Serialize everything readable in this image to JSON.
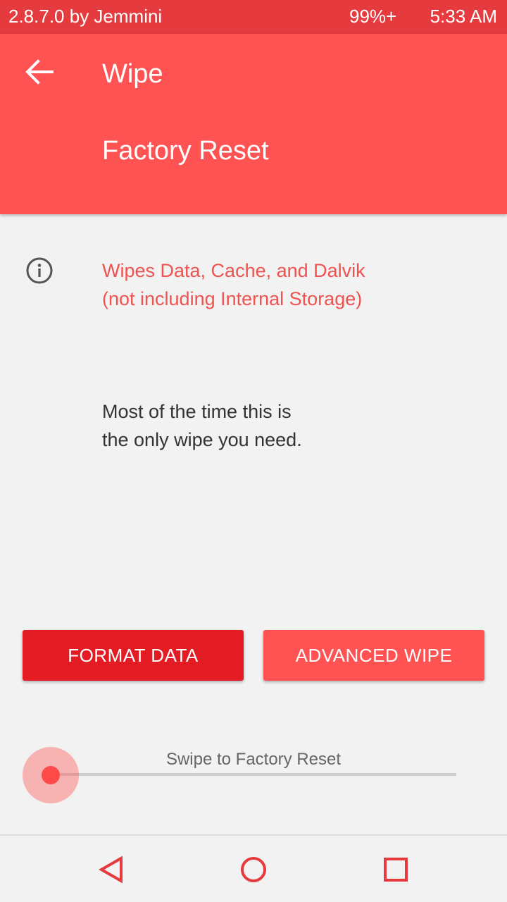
{
  "status_bar": {
    "left_text": "2.8.7.0 by Jemmini",
    "battery": "99%+",
    "time": "5:33 AM"
  },
  "header": {
    "back_icon": "arrow-left-icon",
    "title": "Wipe",
    "subtitle": "Factory Reset"
  },
  "info": {
    "icon": "info-icon",
    "line1": "Wipes Data, Cache, and Dalvik",
    "line2": "(not including Internal Storage)"
  },
  "description": {
    "line1": "Most of the time this is",
    "line2": "the only wipe you need."
  },
  "buttons": {
    "format_data": "FORMAT DATA",
    "advanced_wipe": "ADVANCED WIPE"
  },
  "swipe": {
    "label": "Swipe to Factory Reset",
    "progress": 0
  },
  "nav": {
    "back_icon": "triangle-back-icon",
    "home_icon": "circle-home-icon",
    "recent_icon": "square-recent-icon"
  },
  "colors": {
    "status_bar": "#e53b3e",
    "accent": "#ff5252",
    "format_button": "#e31c24",
    "info_text": "#ef5350"
  }
}
